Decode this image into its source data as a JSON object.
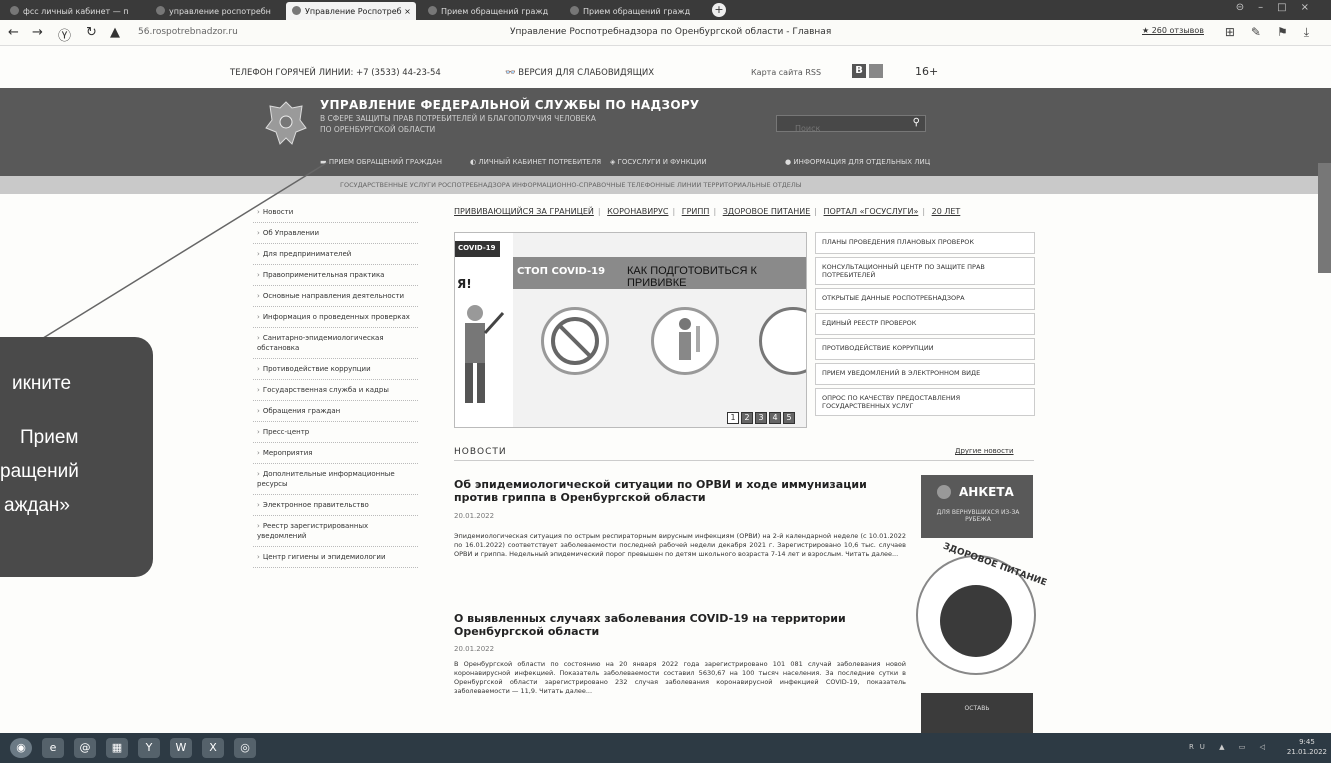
{
  "browser": {
    "tabs": [
      {
        "label": "фсс личный кабинет — п"
      },
      {
        "label": "управление роспотребн"
      },
      {
        "label": "Управление Роспотреб ×"
      },
      {
        "label": "Прием обращений гражд"
      },
      {
        "label": "Прием обращений гражд"
      }
    ],
    "new_tab": "+",
    "url": "56.rospotrebnadzor.ru",
    "page_title": "Управление Роспотребнадзора по Оренбургской области - Главная",
    "reviews": "★ 260 отзывов"
  },
  "topline": {
    "hotline": "ТЕЛЕФОН ГОРЯЧЕЙ ЛИНИИ: +7 (3533) 44-23-54",
    "blind": "ВЕРСИЯ ДЛЯ СЛАБОВИДЯЩИХ",
    "sitemap": "Карта сайта  RSS",
    "b_label": "B",
    "age": "16+"
  },
  "header": {
    "org_title": "УПРАВЛЕНИЕ ФЕДЕРАЛЬНОЙ СЛУЖБЫ ПО НАДЗОРУ",
    "org_line2": "В СФЕРЕ ЗАЩИТЫ ПРАВ ПОТРЕБИТЕЛЕЙ И БЛАГОПОЛУЧИЯ ЧЕЛОВЕКА",
    "org_line3": "ПО ОРЕНБУРГСКОЙ ОБЛАСТИ",
    "search_placeholder": "Поиск",
    "nav": [
      "ПРИЕМ ОБРАЩЕНИЙ ГРАЖДАН",
      "ЛИЧНЫЙ КАБИНЕТ ПОТРЕБИТЕЛЯ",
      "ГОСУСЛУГИ И ФУНКЦИИ",
      "ИНФОРМАЦИЯ ДЛЯ ОТДЕЛЬНЫХ ЛИЦ"
    ],
    "subnav": "ГОСУДАРСТВЕННЫЕ УСЛУГИ РОСПОТРЕБНАДЗОРА   ИНФОРМАЦИОННО-СПРАВОЧНЫЕ ТЕЛЕФОННЫЕ ЛИНИИ   ТЕРРИТОРИАЛЬНЫЕ ОТДЕЛЫ"
  },
  "sidebar": {
    "items": [
      "Новости",
      "Об Управлении",
      "Для предпринимателей",
      "Правоприменительная практика",
      "Основные направления деятельности",
      "Информация о проведенных проверках",
      "Санитарно-эпидемиологическая обстановка",
      "Противодействие коррупции",
      "Государственная служба и кадры",
      "Обращения граждан",
      "Пресс-центр",
      "Мероприятия",
      "Дополнительные информационные ресурсы",
      "Электронное правительство",
      "Реестр зарегистрированных уведомлений",
      "Центр гигиены и эпидемиологии"
    ]
  },
  "toplinks": [
    "ПРИВИВАЮЩИЙСЯ ЗА ГРАНИЦЕЙ",
    "КОРОНАВИРУС",
    "ГРИПП",
    "ЗДОРОВОЕ ПИТАНИЕ",
    "ПОРТАЛ «ГОСУСЛУГИ»",
    "20 ЛЕТ"
  ],
  "banner": {
    "tag": "COVID-19",
    "side_letter": "Я!",
    "logo": "СТОП COVID-19",
    "headline": "КАК ПОДГОТОВИТЬСЯ К ПРИВИВКЕ",
    "pages": [
      "1",
      "2",
      "3",
      "4",
      "5"
    ]
  },
  "right_links": [
    "ПЛАНЫ ПРОВЕДЕНИЯ ПЛАНОВЫХ ПРОВЕРОК",
    "КОНСУЛЬТАЦИОННЫЙ ЦЕНТР ПО ЗАЩИТЕ ПРАВ ПОТРЕБИТЕЛЕЙ",
    "ОТКРЫТЫЕ ДАННЫЕ РОСПОТРЕБНАДЗОРА",
    "ЕДИНЫЙ РЕЕСТР ПРОВЕРОК",
    "ПРОТИВОДЕЙСТВИЕ КОРРУПЦИИ",
    "ПРИЕМ УВЕДОМЛЕНИЙ В ЭЛЕКТРОННОМ ВИДЕ",
    "ОПРОС ПО КАЧЕСТВУ ПРЕДОСТАВЛЕНИЯ ГОСУДАРСТВЕННЫХ УСЛУГ"
  ],
  "news": {
    "heading": "НОВОСТИ",
    "all_link": "Другие новости",
    "items": [
      {
        "title": "Об эпидемиологической ситуации по ОРВИ и ходе иммунизации против гриппа в Оренбургской области",
        "date": "20.01.2022",
        "text": "Эпидемиологическая ситуация по острым респираторным вирусным инфекциям (ОРВИ) на 2-й календарной неделе (с 10.01.2022 по 16.01.2022) соответствует заболеваемости последней рабочей недели декабря 2021 г. Зарегистрировано 10,6 тыс. случаев ОРВИ и гриппа. Недельный эпидемический порог превышен по детям школьного возраста 7-14 лет и взрослым. Читать далее..."
      },
      {
        "title": "О выявленных случаях заболевания COVID-19 на территории Оренбургской области",
        "date": "20.01.2022",
        "text": "В Оренбургской области по состоянию на 20 января 2022 года зарегистрировано 101 081 случай заболевания новой коронавирусной инфекцией. Показатель заболеваемости составил 5630,67 на 100 тысяч населения. За последние сутки в Оренбургской области зарегистрировано 232 случая заболевания коронавирусной инфекцией COVID-19, показатель заболеваемости — 11,9. Читать далее..."
      }
    ]
  },
  "promos": {
    "anketa_title": "АНКЕТА",
    "anketa_sub": "ДЛЯ ВЕРНУВШИХСЯ ИЗ-ЗА РУБЕЖА",
    "zdorov": "ЗДОРОВОЕ ПИТАНИЕ",
    "promo3": "ОСТАВЬ"
  },
  "callout": {
    "lines": [
      "икните",
      "Прием",
      "ращений",
      "аждан»"
    ]
  },
  "taskbar": {
    "lang": "RU",
    "time": "9:45",
    "date": "21.01.2022"
  },
  "colors": {
    "header_bg": "#595959",
    "callout_bg": "#4a4a4a",
    "taskbar_bg": "#2d3a44"
  }
}
